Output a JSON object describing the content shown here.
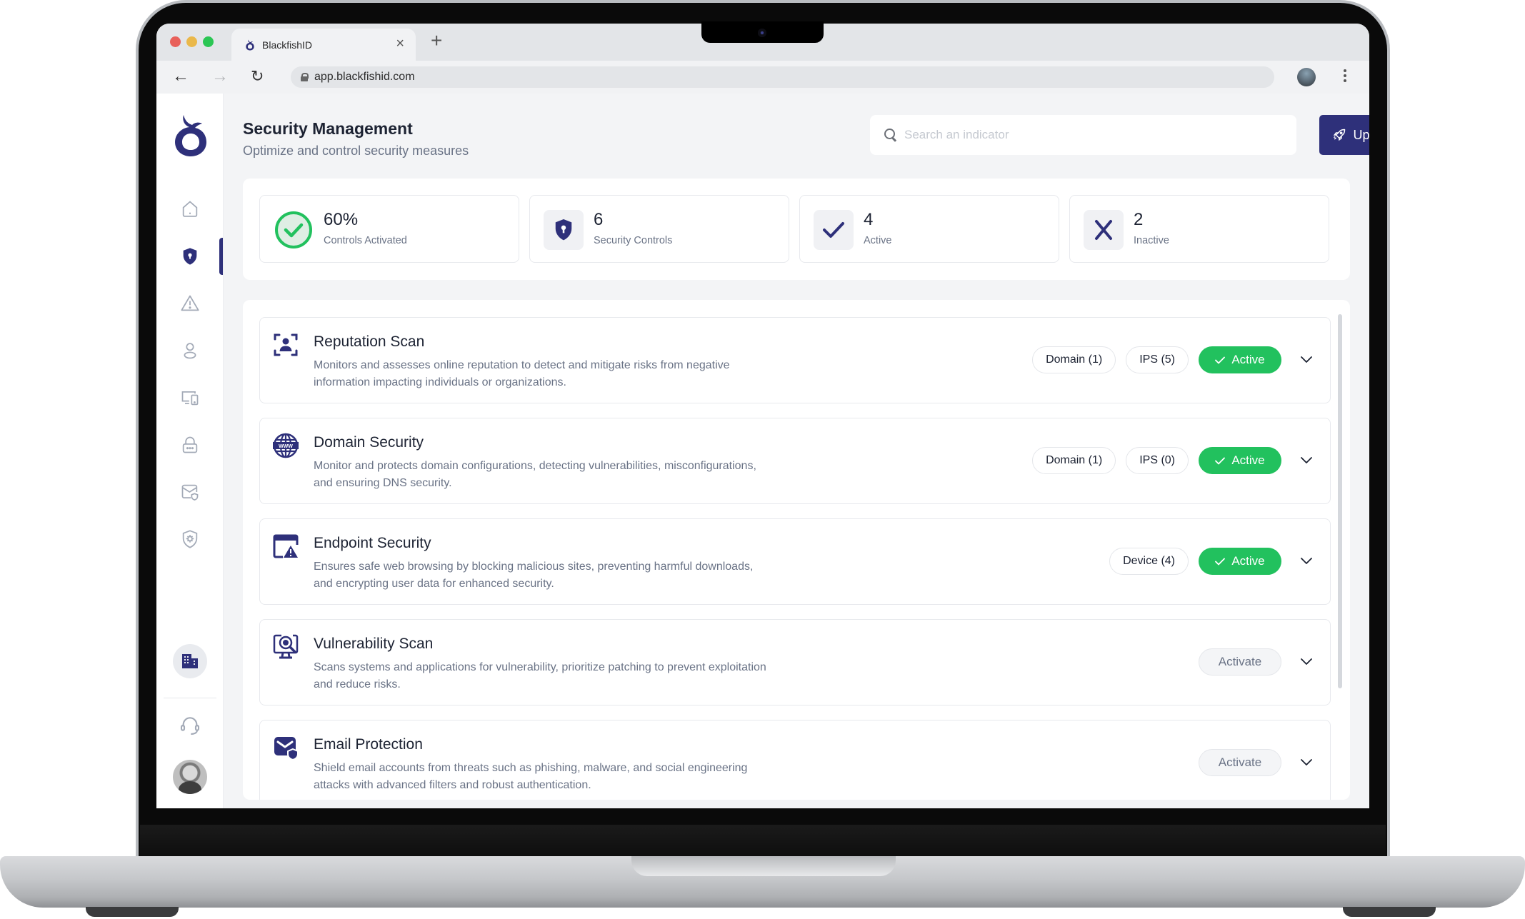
{
  "browser": {
    "tab_title": "BlackfishID",
    "url": "app.blackfishid.com"
  },
  "header": {
    "title": "Security Management",
    "subtitle": "Optimize and control security measures",
    "search_placeholder": "Search an indicator",
    "search_value": "",
    "upgrade_label": "Upgrade"
  },
  "sidebar": {
    "items": [
      {
        "name": "home",
        "icon": "home-icon",
        "active": false
      },
      {
        "name": "security",
        "icon": "shield-keyhole-icon",
        "active": true
      },
      {
        "name": "alerts",
        "icon": "warning-triangle-icon",
        "active": false
      },
      {
        "name": "users",
        "icon": "user-icon",
        "active": false
      },
      {
        "name": "devices",
        "icon": "devices-icon",
        "active": false
      },
      {
        "name": "passwords",
        "icon": "lock-icon",
        "active": false
      },
      {
        "name": "email",
        "icon": "mail-shield-icon",
        "active": false
      },
      {
        "name": "settings",
        "icon": "shield-gear-icon",
        "active": false
      }
    ]
  },
  "stats": [
    {
      "value": "60%",
      "label": "Controls Activated",
      "icon": "check-circle-icon"
    },
    {
      "value": "6",
      "label": "Security Controls",
      "icon": "shield-keyhole-icon"
    },
    {
      "value": "4",
      "label": "Active",
      "icon": "check-icon"
    },
    {
      "value": "2",
      "label": "Inactive",
      "icon": "x-icon"
    }
  ],
  "controls": [
    {
      "title": "Reputation Scan",
      "description": "Monitors and assesses online reputation to detect and mitigate risks from negative information impacting individuals or organizations.",
      "icon": "user-scan-icon",
      "tags": [
        "Domain (1)",
        "IPS (5)"
      ],
      "status": "Active"
    },
    {
      "title": "Domain Security",
      "description": "Monitor and protects domain configurations, detecting vulnerabilities, misconfigurations, and ensuring DNS security.",
      "icon": "globe-www-icon",
      "tags": [
        "Domain (1)",
        "IPS (0)"
      ],
      "status": "Active"
    },
    {
      "title": "Endpoint Security",
      "description": "Ensures safe web browsing by blocking malicious sites, preventing harmful downloads, and encrypting user data for enhanced security.",
      "icon": "browser-warning-icon",
      "tags": [
        "Device (4)"
      ],
      "status": "Active"
    },
    {
      "title": "Vulnerability Scan",
      "description": "Scans systems and applications for vulnerability, prioritize patching to prevent exploitation and reduce risks.",
      "icon": "monitor-bug-search-icon",
      "tags": [],
      "status": "Activate"
    },
    {
      "title": "Email Protection",
      "description": "Shield email accounts from threats such as phishing, malware, and social engineering attacks with advanced filters and robust authentication.",
      "icon": "mail-shield-icon",
      "tags": [],
      "status": "Activate"
    }
  ],
  "colors": {
    "brand": "#2e307a",
    "active_green": "#22c15e",
    "text_primary": "#1d2333",
    "text_secondary": "#6a7386"
  }
}
